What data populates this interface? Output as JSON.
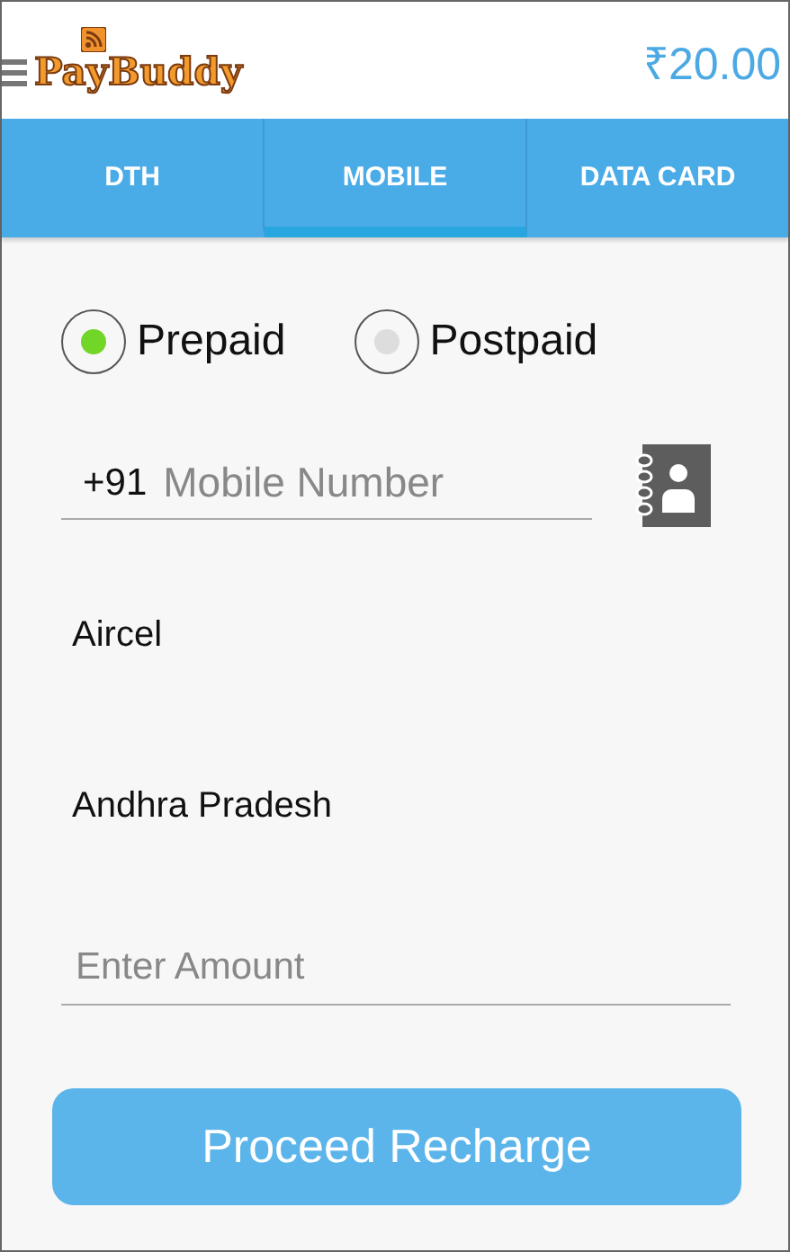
{
  "header": {
    "logo": "PayBuddy",
    "balance": "₹20.00"
  },
  "tabs": [
    {
      "label": "DTH",
      "selected": false
    },
    {
      "label": "MOBILE",
      "selected": true
    },
    {
      "label": "DATA CARD",
      "selected": false
    }
  ],
  "plan_types": [
    {
      "label": "Prepaid",
      "selected": true
    },
    {
      "label": "Postpaid",
      "selected": false
    }
  ],
  "mobile": {
    "prefix": "+91",
    "placeholder": "Mobile Number"
  },
  "operator": "Aircel",
  "circle": "Andhra Pradesh",
  "amount": {
    "placeholder": "Enter Amount"
  },
  "submit": "Proceed Recharge"
}
